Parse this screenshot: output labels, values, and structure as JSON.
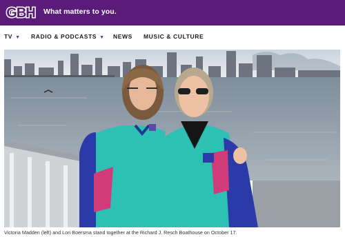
{
  "header": {
    "logo_text": "GBH",
    "tagline": "What matters to you."
  },
  "nav": {
    "items": [
      {
        "label": "TV",
        "has_dropdown": true
      },
      {
        "label": "RADIO & PODCASTS",
        "has_dropdown": true
      },
      {
        "label": "NEWS",
        "has_dropdown": false
      },
      {
        "label": "MUSIC & CULTURE",
        "has_dropdown": false
      }
    ],
    "dropdown_icon": "chevron-down-icon"
  },
  "photo": {
    "caption": "Victoria Madden (left) and Lori Boersma stand together at the Richard J. Resch Boathouse on October 17."
  },
  "colors": {
    "brand": "#5b1b78",
    "accent": "#7a2aa0",
    "jacket_teal": "#2cc1b3",
    "jacket_blue": "#2a3aa8"
  }
}
